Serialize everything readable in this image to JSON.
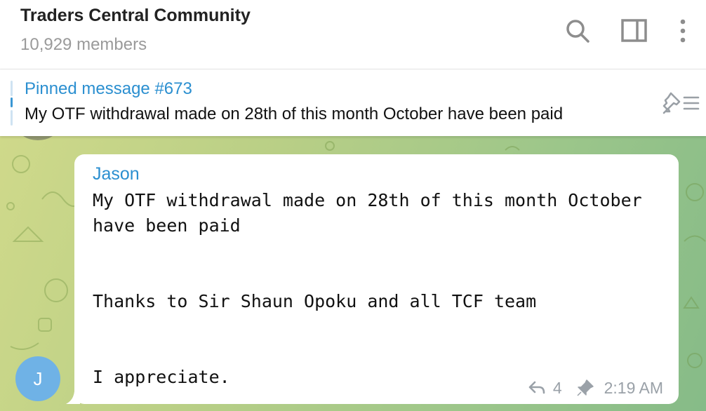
{
  "header": {
    "title": "Traders Central Community",
    "subtitle": "10,929 members",
    "icons": [
      "search-icon",
      "sidebar-toggle-icon",
      "more-vertical-icon"
    ]
  },
  "pinned": {
    "title": "Pinned message #673",
    "text": "My OTF withdrawal made on 28th of this month October have been paid",
    "icon": "pin-list-icon"
  },
  "message": {
    "sender": "Jason",
    "text": "My OTF withdrawal made on 28th of this month October have been paid\n\n\nThanks to Sir Shaun Opoku and all TCF team\n\n\nI appreciate.",
    "replies": "4",
    "time": "2:19 AM",
    "avatar_initial": "J"
  },
  "colors": {
    "accent": "#2b8fd0",
    "avatar": "#6fb2e6",
    "chat_bg_start": "#cfd98a",
    "chat_bg_end": "#86bb88"
  }
}
